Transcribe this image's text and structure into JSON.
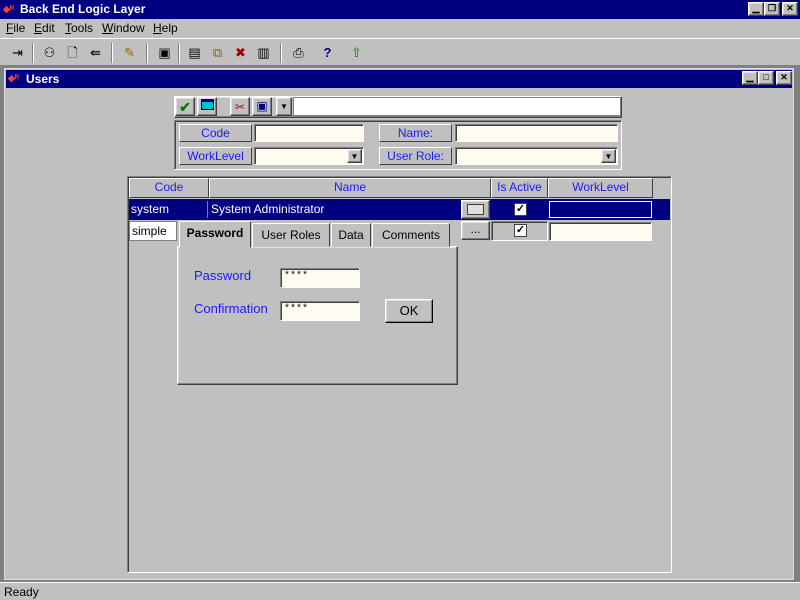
{
  "app": {
    "title": "Back End Logic Layer",
    "icon": "app-logo-icon"
  },
  "menu": {
    "file": "File",
    "edit": "Edit",
    "tools": "Tools",
    "window": "Window",
    "help": "Help"
  },
  "toolbar_icons": [
    "exit-icon",
    "users-icon",
    "new-document-icon",
    "import-icon",
    "eraser-icon",
    "save-icon",
    "save-all-icon",
    "copy-icon",
    "delete-icon",
    "save-as-icon",
    "print-icon",
    "help-icon",
    "upload-icon"
  ],
  "child": {
    "title": "Users"
  },
  "filter": {
    "code_label": "Code",
    "name_label": "Name:",
    "worklevel_label": "WorkLevel",
    "userrole_label": "User Role:",
    "code_value": "",
    "name_value": "",
    "worklevel_value": "",
    "userrole_value": ""
  },
  "grid": {
    "headers": {
      "code": "Code",
      "name": "Name",
      "is_active": "Is Active",
      "worklevel": "WorkLevel"
    },
    "rows": [
      {
        "code": "system",
        "name": "System Administrator",
        "is_active": true,
        "worklevel": ""
      },
      {
        "code": "simple",
        "name": "",
        "is_active": true,
        "worklevel": ""
      }
    ],
    "ellipsis": "..."
  },
  "popup": {
    "tabs": [
      "Password",
      "User Roles",
      "Data",
      "Comments"
    ],
    "active_tab": "Password",
    "password_label": "Password",
    "confirmation_label": "Confirmation",
    "password_value": "****",
    "confirmation_value": "****",
    "ok_label": "OK"
  },
  "status": {
    "text": "Ready"
  },
  "colors": {
    "title": "#000080",
    "label": "#1a1aff",
    "field": "#fffbf0",
    "selected_row": "#000080"
  }
}
